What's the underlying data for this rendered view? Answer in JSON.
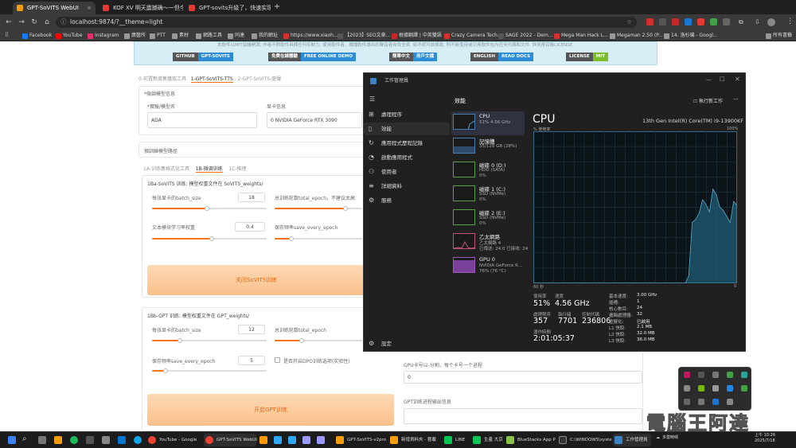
{
  "browser": {
    "tabs": [
      {
        "label": "GPT-SoVITS WebUI",
        "color": "#f59e0b"
      },
      {
        "label": "KOF XV 明天震撼确～一但今",
        "color": "#e53935"
      },
      {
        "label": "GPT-sovits升级了，快速实现P",
        "color": "#e53935"
      }
    ],
    "new_tab": "+",
    "url": "localhost:9874/?__theme=light",
    "bookmarks": [
      {
        "label": "Facebook",
        "color": "#1877f2"
      },
      {
        "label": "YouTube",
        "color": "#ff0000"
      },
      {
        "label": "Instagram",
        "color": "#e1306c"
      },
      {
        "label": "廣藝所",
        "color": "#888"
      },
      {
        "label": "PTT",
        "color": "#888"
      },
      {
        "label": "素材",
        "color": "#888"
      },
      {
        "label": "網路工具",
        "color": "#888"
      },
      {
        "label": "同達",
        "color": "#888"
      },
      {
        "label": "我的網址",
        "color": "#888"
      },
      {
        "label": "https://www.xiaoh...",
        "color": "#d32f2f"
      },
      {
        "label": "【2023】SEO文章...",
        "color": "#555"
      },
      {
        "label": "根據翻譯 | 中英雙語",
        "color": "#c62828"
      },
      {
        "label": "Crazy Camera Tech...",
        "color": "#d32f2f"
      },
      {
        "label": "SAGE 2022 - Dem...",
        "color": "#555"
      },
      {
        "label": "Mega Man Hack L...",
        "color": "#d32f2f"
      },
      {
        "label": "Megaman 2.50 (P...",
        "color": "#888"
      },
      {
        "label": "14. 洛杉磯 - Googl...",
        "color": "#888"
      },
      {
        "label": "所有書籤",
        "color": "#888"
      }
    ]
  },
  "webui": {
    "banner_note": "本軟件以MIT協議開源, 作者不對軟件具備任何控制力, 使用軟件者、傳播軟件導出的聲音者自負全責. 如不認可該條款, 則不能使用或引用軟件包內任何代碼和文件. 詳見根目錄LICENSE.",
    "badges": [
      {
        "left": "GITHUB",
        "right": "GPT-SOVITS"
      },
      {
        "left": "免費在線體驗",
        "right": "FREE ONLINE DEMO"
      },
      {
        "left": "簡單中文",
        "right": "用戶文檔"
      },
      {
        "left": "ENGLISH",
        "right": "READ DOCS"
      },
      {
        "left": "LICENSE",
        "right": "MIT"
      }
    ],
    "main_tabs": [
      "0-前置數據集獲取工具",
      "1-GPT-SoVITS-TTS",
      "2-GPT-SoVITS-變聲"
    ],
    "model_info_label": "*微調模型信息",
    "model_name_label": "*實驗/模型名",
    "model_name_value": "ADA",
    "gpu_info_label": "显卡信息",
    "gpu_info_value": "0 NVIDIA GeForce RTX 3090",
    "pretrained_label": "預訓練模型路徑",
    "sub_tabs": [
      "1A-训练集格式化工具",
      "1B-微调训练",
      "1C-推理"
    ],
    "sovits_title": "1Ba-SoVITS 训练: 模型权重文件在 SoVITS_weights/",
    "sovits_batch_label": "每张显卡的batch_size",
    "sovits_batch_value": "18",
    "sovits_total_epoch_label": "总训练轮数total_epoch，不建议太高",
    "sovits_lr_label": "文本模块学习率权重",
    "sovits_lr_value": "0.4",
    "sovits_save_label": "保存频率save_every_epoch",
    "sovits_button": "关闭SoVITS训练",
    "gpt_title": "1Bb-GPT 训练: 模型权重文件在 GPT_weights/",
    "gpt_batch_label": "每张显卡的batch_size",
    "gpt_batch_value": "12",
    "gpt_total_epoch_label": "总训练轮数total_epoch",
    "gpt_save_label": "保存频率save_every_epoch",
    "gpt_save_value": "5",
    "dpo_label": "是否开启DPO训练选项(实验性)",
    "gpu_ids_label": "GPU卡号以-分割，每个卡号一个进程",
    "gpu_ids_value": "0",
    "gpt_button": "开启GPT训练",
    "gpt_output_label": "GPT训练进程输出信息"
  },
  "taskmanager": {
    "title": "工作管理員",
    "nav": [
      "處理程序",
      "效能",
      "應用程式歷程記錄",
      "啟動應用程式",
      "使用者",
      "詳細資料",
      "服務"
    ],
    "settings": "設定",
    "section_title": "效能",
    "run_task": "執行新工作",
    "more": "···",
    "devices": [
      {
        "name": "CPU",
        "s1": "51% 4.56 GHz",
        "s2": "",
        "color": "#4a9fd8"
      },
      {
        "name": "記憶體",
        "s1": "35/128 GB (28%)",
        "s2": "",
        "color": "#4a7ab0"
      },
      {
        "name": "磁碟 0 (D:)",
        "s1": "HDD (SATA)",
        "s2": "0%",
        "color": "#5a9f4a"
      },
      {
        "name": "磁碟 1 (C:)",
        "s1": "SSD (NVMe)",
        "s2": "0%",
        "color": "#5a9f4a"
      },
      {
        "name": "磁碟 2 (E:)",
        "s1": "SSD (NVMe)",
        "s2": "0%",
        "color": "#5a9f4a"
      },
      {
        "name": "乙太網路",
        "s1": "乙太網路 4",
        "s2": "已傳送: 24.0 已接收: 24",
        "color": "#c2557e"
      },
      {
        "name": "GPU 0",
        "s1": "NVIDIA GeForce R...",
        "s2": "76% (76 °C)",
        "color": "#9b59b6"
      }
    ],
    "cpu_title": "CPU",
    "cpu_model": "13th Gen Intel(R) Core(TM) i9-13900KF",
    "usage_label": "% 使用率",
    "pct_max": "100%",
    "time_label": "60 秒",
    "time_end": "0",
    "stats": [
      {
        "label": "使用率",
        "value": "51%"
      },
      {
        "label": "速度",
        "value": "4.56 GHz"
      },
      {
        "label": "處理程序",
        "value": "357"
      },
      {
        "label": "執行緒",
        "value": "7701"
      },
      {
        "label": "控制代碼",
        "value": "236806"
      },
      {
        "label": "運作時間",
        "value": "2:01:05:37"
      }
    ],
    "specs": [
      {
        "k": "基本速度:",
        "v": "3.00 GHz"
      },
      {
        "k": "插槽:",
        "v": "1"
      },
      {
        "k": "核心數目:",
        "v": "24"
      },
      {
        "k": "邏輯處理器:",
        "v": "32"
      },
      {
        "k": "虛擬化:",
        "v": "已啟用"
      },
      {
        "k": "L1 快取:",
        "v": "2.1 MB"
      },
      {
        "k": "L2 快取:",
        "v": "32.0 MB"
      },
      {
        "k": "L3 快取:",
        "v": "36.0 MB"
      }
    ],
    "cpu_history": [
      0,
      0,
      0,
      0,
      0,
      0,
      0,
      0,
      0,
      0,
      0,
      0,
      0,
      0,
      0,
      0,
      0,
      0,
      0,
      0,
      0,
      0,
      0,
      0,
      0,
      0,
      0,
      0,
      0,
      0,
      0,
      0,
      0,
      0,
      0,
      0,
      0,
      0,
      0,
      0,
      0,
      0,
      0,
      0,
      0,
      5,
      40,
      42,
      46,
      55,
      52,
      47,
      62,
      58,
      50,
      48,
      44,
      40,
      54,
      51
    ]
  },
  "taskbar": {
    "items": [
      "YouTube - Google",
      "GPT-SoVITS WebUI",
      "GPT-SoVITS-v2pro",
      "新增資料夾 - 藝載",
      "LINE",
      "生產 大京",
      "BlueStacks App P",
      "C:\\WINDOWS\\syste",
      "工作管理員"
    ],
    "weather": "多雲時晴",
    "time": "上午 10:26",
    "date": "2025/7/18"
  },
  "watermark": "電腦王阿達"
}
